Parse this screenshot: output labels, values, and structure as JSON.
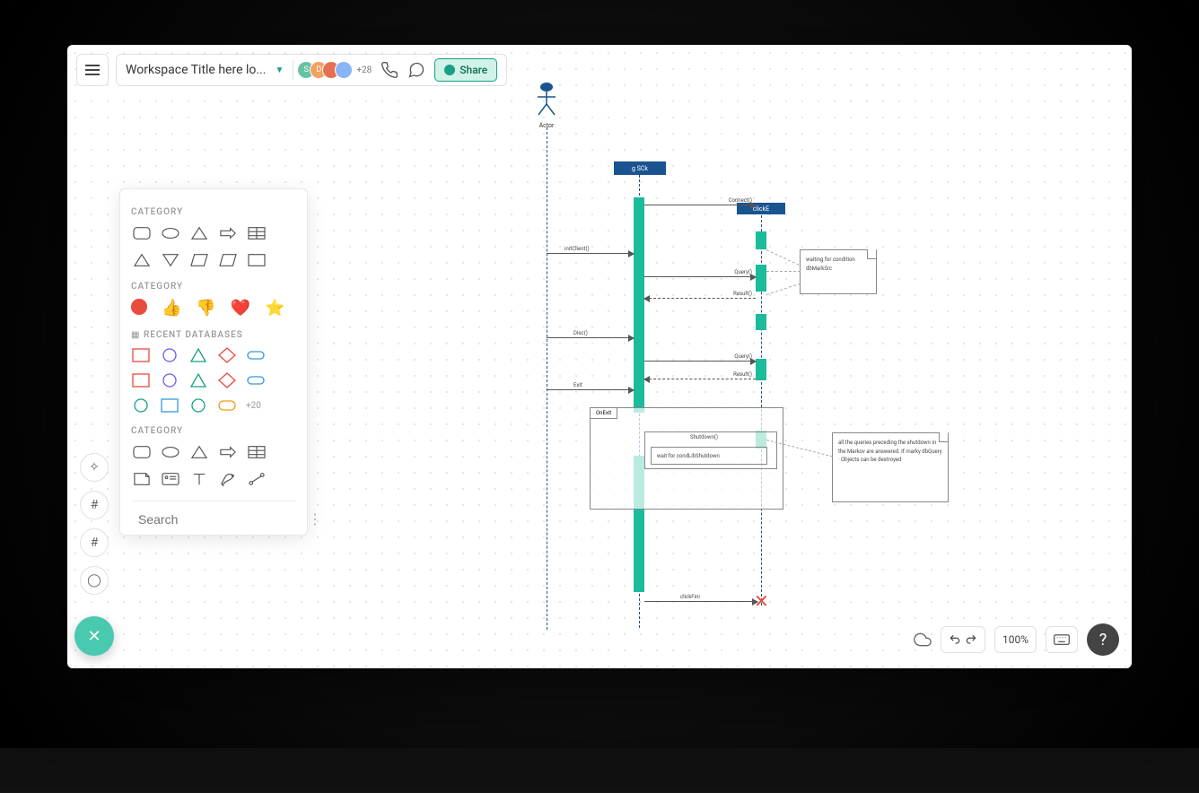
{
  "header": {
    "workspace_title": "Workspace Title here lo...",
    "avatar_overflow": "+28",
    "share_label": "Share"
  },
  "shapes_panel": {
    "cat1_label": "CATEGORY",
    "cat2_label": "CATEGORY",
    "cat3_label": "RECENT DATABASES",
    "cat4_label": "CATEGORY",
    "more_count": "+20",
    "search_placeholder": "Search"
  },
  "bottom_bar": {
    "zoom": "100%"
  },
  "diagram": {
    "actor_label": "Actor",
    "lifeline1": "g SCk",
    "lifeline2": "clickE",
    "msg_conn": "Connect()",
    "msg_initclient": "initClient()",
    "msg_query1": "Query()",
    "msg_result1": "Result()",
    "msg_disc": "Disc()",
    "msg_query2": "Query()",
    "msg_result2": "Result()",
    "msg_exit": "Exit",
    "msg_shutdown": "Shutdown()",
    "msg_wait": "wait    for    condLibShutdown",
    "msg_final": "clickFini",
    "note1": "waiting for condition dbMarkSrc",
    "note2": "all the queries preceding the shutdown in the Markov are answered. If marky dbQuery · Objects can be destroyed",
    "frag_label": "OnExit"
  }
}
